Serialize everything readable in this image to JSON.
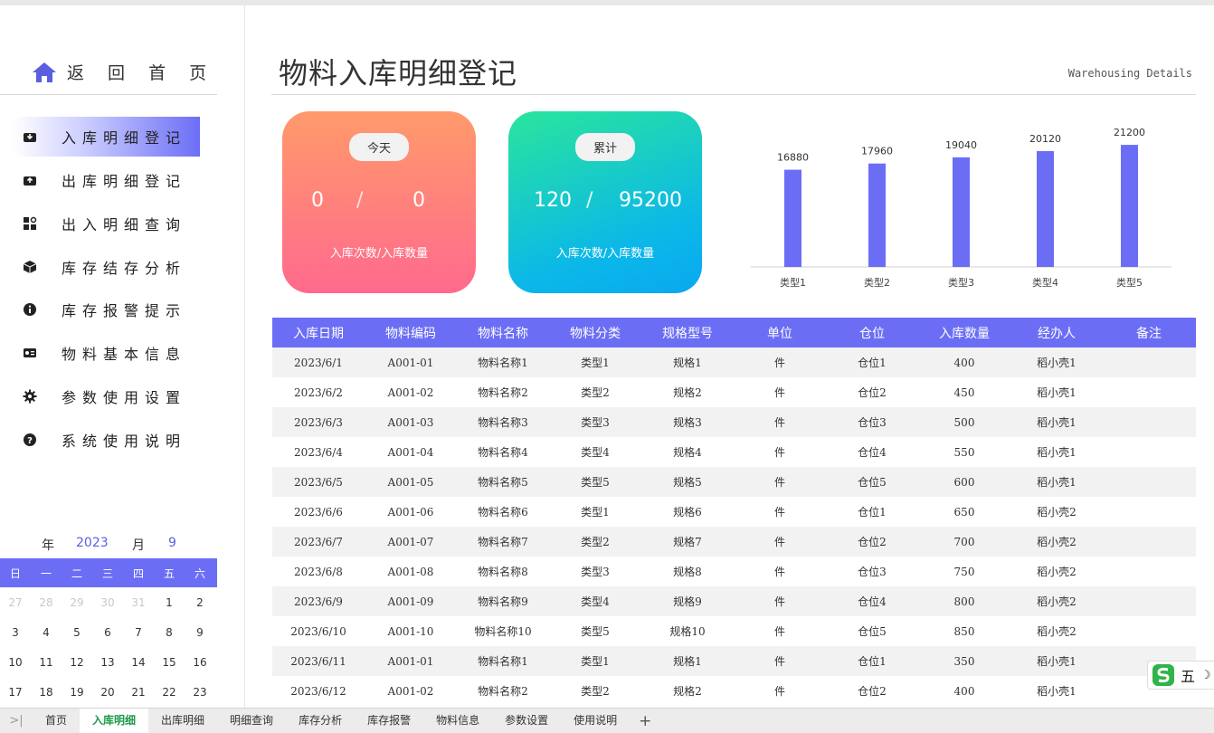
{
  "sidebar": {
    "home_label": "返 回 首 页",
    "nav": [
      {
        "label": "入库明细登记",
        "icon": "inbox-down-icon",
        "active": true
      },
      {
        "label": "出库明细登记",
        "icon": "inbox-up-icon",
        "active": false
      },
      {
        "label": "出入明细查询",
        "icon": "grid-search-icon",
        "active": false
      },
      {
        "label": "库存结存分析",
        "icon": "box-icon",
        "active": false
      },
      {
        "label": "库存报警提示",
        "icon": "info-icon",
        "active": false
      },
      {
        "label": "物料基本信息",
        "icon": "id-card-icon",
        "active": false
      },
      {
        "label": "参数使用设置",
        "icon": "gear-icon",
        "active": false
      },
      {
        "label": "系统使用说明",
        "icon": "help-icon",
        "active": false
      }
    ],
    "calendar": {
      "year_label": "年",
      "year": "2023",
      "month_label": "月",
      "month": "9",
      "weekdays": [
        "日",
        "一",
        "二",
        "三",
        "四",
        "五",
        "六"
      ],
      "rows": [
        [
          [
            "27",
            true
          ],
          [
            "28",
            true
          ],
          [
            "29",
            true
          ],
          [
            "30",
            true
          ],
          [
            "31",
            true
          ],
          [
            "1",
            false
          ],
          [
            "2",
            false
          ]
        ],
        [
          [
            "3",
            false
          ],
          [
            "4",
            false
          ],
          [
            "5",
            false
          ],
          [
            "6",
            false
          ],
          [
            "7",
            false
          ],
          [
            "8",
            false
          ],
          [
            "9",
            false
          ]
        ],
        [
          [
            "10",
            false
          ],
          [
            "11",
            false
          ],
          [
            "12",
            false
          ],
          [
            "13",
            false
          ],
          [
            "14",
            false
          ],
          [
            "15",
            false
          ],
          [
            "16",
            false
          ]
        ],
        [
          [
            "17",
            false
          ],
          [
            "18",
            false
          ],
          [
            "19",
            false
          ],
          [
            "20",
            false
          ],
          [
            "21",
            false
          ],
          [
            "22",
            false
          ],
          [
            "23",
            false
          ]
        ]
      ]
    }
  },
  "header": {
    "title": "物料入库明细登记",
    "subtitle": "Warehousing Details"
  },
  "cards": {
    "today": {
      "pill": "今天",
      "count": "0",
      "sep": "/",
      "qty": "0",
      "caption": "入库次数/入库数量"
    },
    "total": {
      "pill": "累计",
      "count": "120",
      "sep": "/",
      "qty": "95200",
      "caption": "入库次数/入库数量"
    }
  },
  "chart_data": {
    "type": "bar",
    "categories": [
      "类型1",
      "类型2",
      "类型3",
      "类型4",
      "类型5"
    ],
    "values": [
      16880,
      17960,
      19040,
      20120,
      21200
    ],
    "bar_color": "#6b6ef5",
    "ylim": [
      0,
      22000
    ]
  },
  "table": {
    "headers": [
      "入库日期",
      "物料编码",
      "物料名称",
      "物料分类",
      "规格型号",
      "单位",
      "仓位",
      "入库数量",
      "经办人",
      "备注"
    ],
    "rows": [
      [
        "2023/6/1",
        "A001-01",
        "物料名称1",
        "类型1",
        "规格1",
        "件",
        "仓位1",
        "400",
        "稻小壳1",
        ""
      ],
      [
        "2023/6/2",
        "A001-02",
        "物料名称2",
        "类型2",
        "规格2",
        "件",
        "仓位2",
        "450",
        "稻小壳1",
        ""
      ],
      [
        "2023/6/3",
        "A001-03",
        "物料名称3",
        "类型3",
        "规格3",
        "件",
        "仓位3",
        "500",
        "稻小壳1",
        ""
      ],
      [
        "2023/6/4",
        "A001-04",
        "物料名称4",
        "类型4",
        "规格4",
        "件",
        "仓位4",
        "550",
        "稻小壳1",
        ""
      ],
      [
        "2023/6/5",
        "A001-05",
        "物料名称5",
        "类型5",
        "规格5",
        "件",
        "仓位5",
        "600",
        "稻小壳1",
        ""
      ],
      [
        "2023/6/6",
        "A001-06",
        "物料名称6",
        "类型1",
        "规格6",
        "件",
        "仓位1",
        "650",
        "稻小壳2",
        ""
      ],
      [
        "2023/6/7",
        "A001-07",
        "物料名称7",
        "类型2",
        "规格7",
        "件",
        "仓位2",
        "700",
        "稻小壳2",
        ""
      ],
      [
        "2023/6/8",
        "A001-08",
        "物料名称8",
        "类型3",
        "规格8",
        "件",
        "仓位3",
        "750",
        "稻小壳2",
        ""
      ],
      [
        "2023/6/9",
        "A001-09",
        "物料名称9",
        "类型4",
        "规格9",
        "件",
        "仓位4",
        "800",
        "稻小壳2",
        ""
      ],
      [
        "2023/6/10",
        "A001-10",
        "物料名称10",
        "类型5",
        "规格10",
        "件",
        "仓位5",
        "850",
        "稻小壳2",
        ""
      ],
      [
        "2023/6/11",
        "A001-01",
        "物料名称1",
        "类型1",
        "规格1",
        "件",
        "仓位1",
        "350",
        "稻小壳1",
        ""
      ],
      [
        "2023/6/12",
        "A001-02",
        "物料名称2",
        "类型2",
        "规格2",
        "件",
        "仓位2",
        "400",
        "稻小壳1",
        ""
      ]
    ]
  },
  "sheet_tabs": [
    {
      "label": "首页",
      "active": false
    },
    {
      "label": "入库明细",
      "active": true
    },
    {
      "label": "出库明细",
      "active": false
    },
    {
      "label": "明细查询",
      "active": false
    },
    {
      "label": "库存分析",
      "active": false
    },
    {
      "label": "库存报警",
      "active": false
    },
    {
      "label": "物料信息",
      "active": false
    },
    {
      "label": "参数设置",
      "active": false
    },
    {
      "label": "使用说明",
      "active": false
    }
  ],
  "ime": {
    "label": "五"
  }
}
